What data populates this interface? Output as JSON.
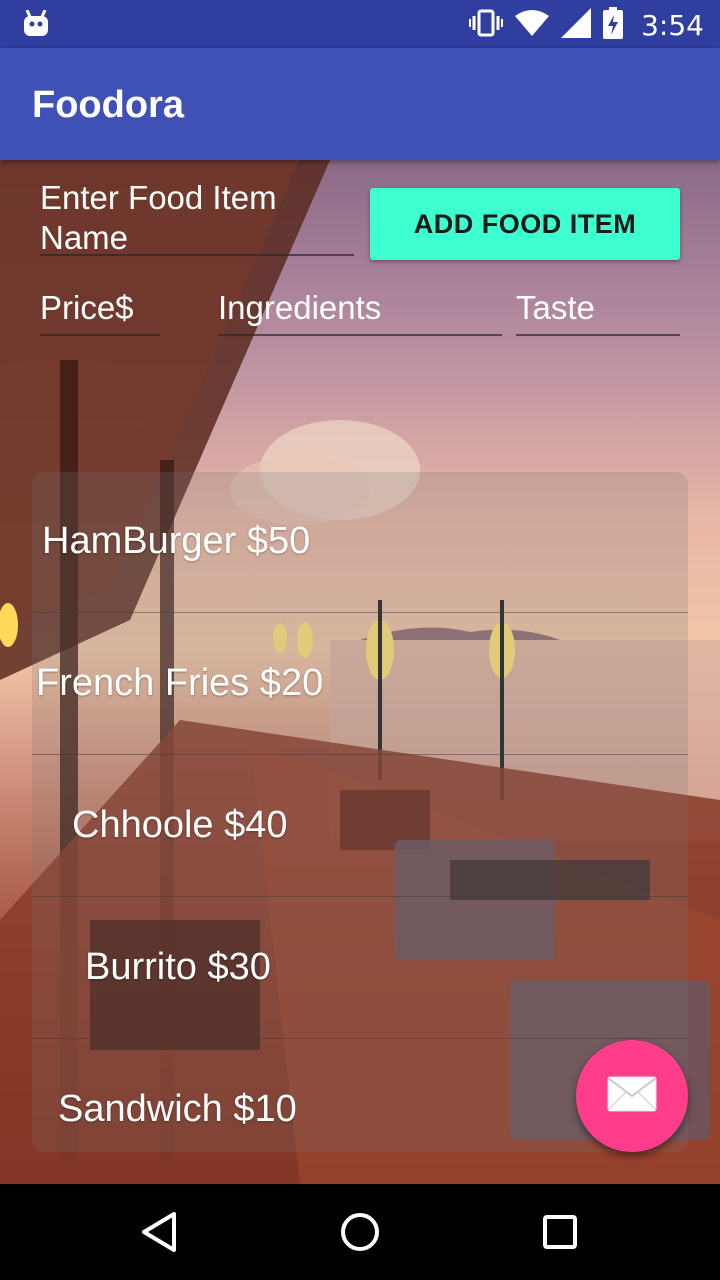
{
  "status_bar": {
    "time": "3:54",
    "icons": [
      "android-icon",
      "vibrate-icon",
      "wifi-icon",
      "signal-icon",
      "battery-charging-icon"
    ]
  },
  "app_bar": {
    "title": "Foodora"
  },
  "form": {
    "food_name_placeholder": "Enter Food Item Name",
    "price_placeholder": "Price$",
    "ingredients_placeholder": "Ingredients",
    "taste_placeholder": "Taste",
    "add_button_label": "ADD FOOD ITEM"
  },
  "food_list": [
    {
      "label": "HamBurger $50"
    },
    {
      "label": "French Fries $20"
    },
    {
      "label": "Chhoole $40"
    },
    {
      "label": "Burrito $30"
    },
    {
      "label": "Sandwich $10"
    }
  ],
  "fab": {
    "icon": "mail-icon"
  },
  "nav_bar": {
    "icons": [
      "back-icon",
      "home-icon",
      "recents-icon"
    ]
  },
  "colors": {
    "status_bar": "#303f9f",
    "app_bar": "#3f51b5",
    "add_button": "#3dffd0",
    "fab": "#ff3d8b"
  }
}
